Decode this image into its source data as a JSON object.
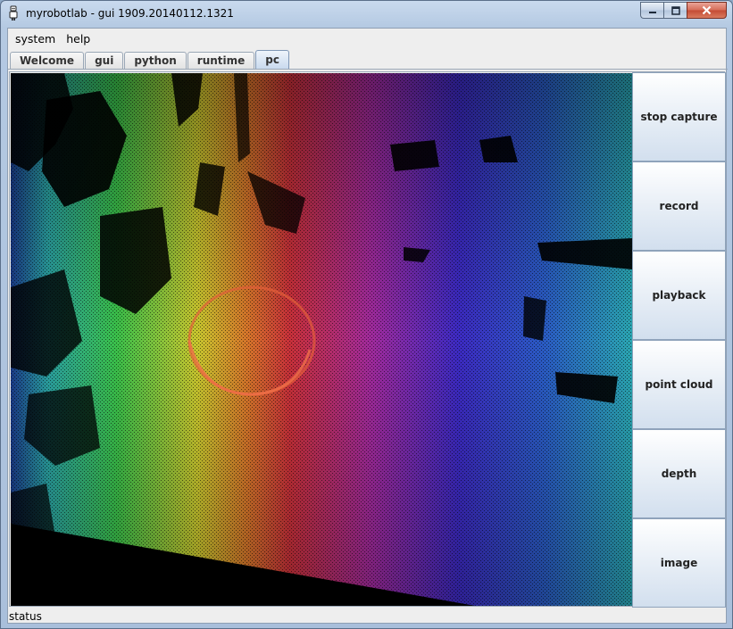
{
  "window": {
    "title": "myrobotlab - gui 1909.20140112.1321",
    "icon": "robot-app-icon",
    "controls": [
      "minimize",
      "maximize",
      "close"
    ]
  },
  "menu": {
    "items": [
      {
        "label": "system"
      },
      {
        "label": "help"
      }
    ]
  },
  "tabs": [
    {
      "label": "Welcome",
      "active": false
    },
    {
      "label": "gui",
      "active": false
    },
    {
      "label": "python",
      "active": false
    },
    {
      "label": "runtime",
      "active": false
    },
    {
      "label": "pc",
      "active": true
    }
  ],
  "side_buttons": [
    {
      "label": "stop capture"
    },
    {
      "label": "record"
    },
    {
      "label": "playback"
    },
    {
      "label": "point cloud"
    },
    {
      "label": "depth"
    },
    {
      "label": "image"
    }
  ],
  "viewport": {
    "content": "point-cloud-depth-render",
    "colors": [
      "#000000",
      "#2bbf4a",
      "#c9c22e",
      "#d45a2a",
      "#c52a3a",
      "#a42a9a",
      "#3a2ac0",
      "#2a6ac4",
      "#2ab0b0"
    ]
  },
  "status": {
    "label": "status"
  }
}
